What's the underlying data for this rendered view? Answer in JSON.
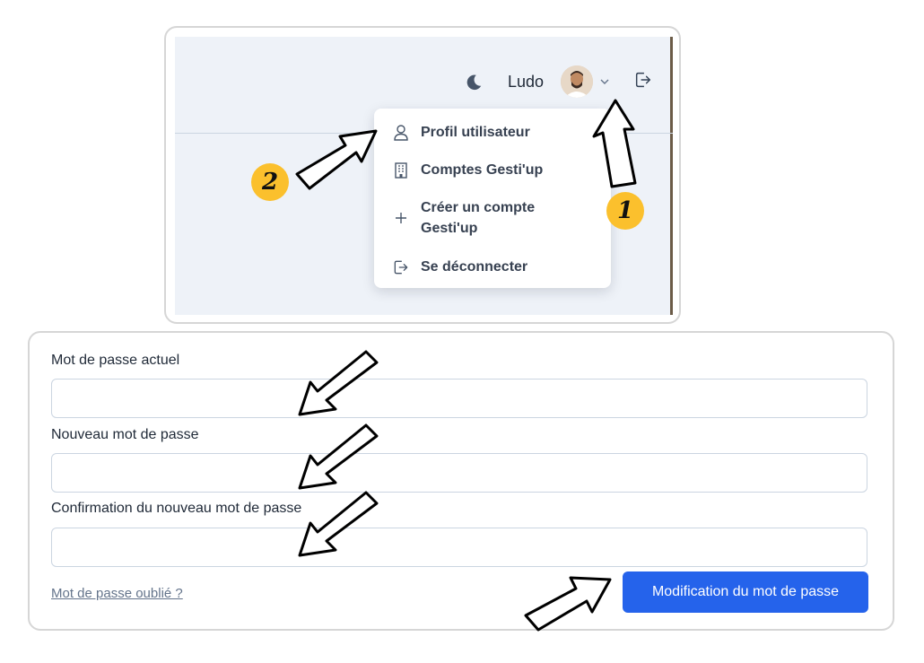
{
  "header": {
    "user_name": "Ludo"
  },
  "user_menu": {
    "items": [
      {
        "label": "Profil utilisateur",
        "icon": "user-icon"
      },
      {
        "label": "Comptes Gesti'up",
        "icon": "building-icon"
      },
      {
        "label": "Créer un compte Gesti'up",
        "icon": "plus-icon"
      },
      {
        "label": "Se déconnecter",
        "icon": "logout-icon"
      }
    ]
  },
  "annotations": {
    "step_1": "1",
    "step_2": "2"
  },
  "form": {
    "current_password_label": "Mot de passe actuel",
    "current_password_value": "",
    "new_password_label": "Nouveau mot de passe",
    "new_password_value": "",
    "confirm_password_label": "Confirmation du nouveau mot de passe",
    "confirm_password_value": "",
    "forgot_link": "Mot de passe oublié ?",
    "submit_label": "Modification du mot de passe"
  },
  "colors": {
    "primary": "#2563eb",
    "header_bg": "#eef2f8",
    "badge": "#fbc02d"
  }
}
